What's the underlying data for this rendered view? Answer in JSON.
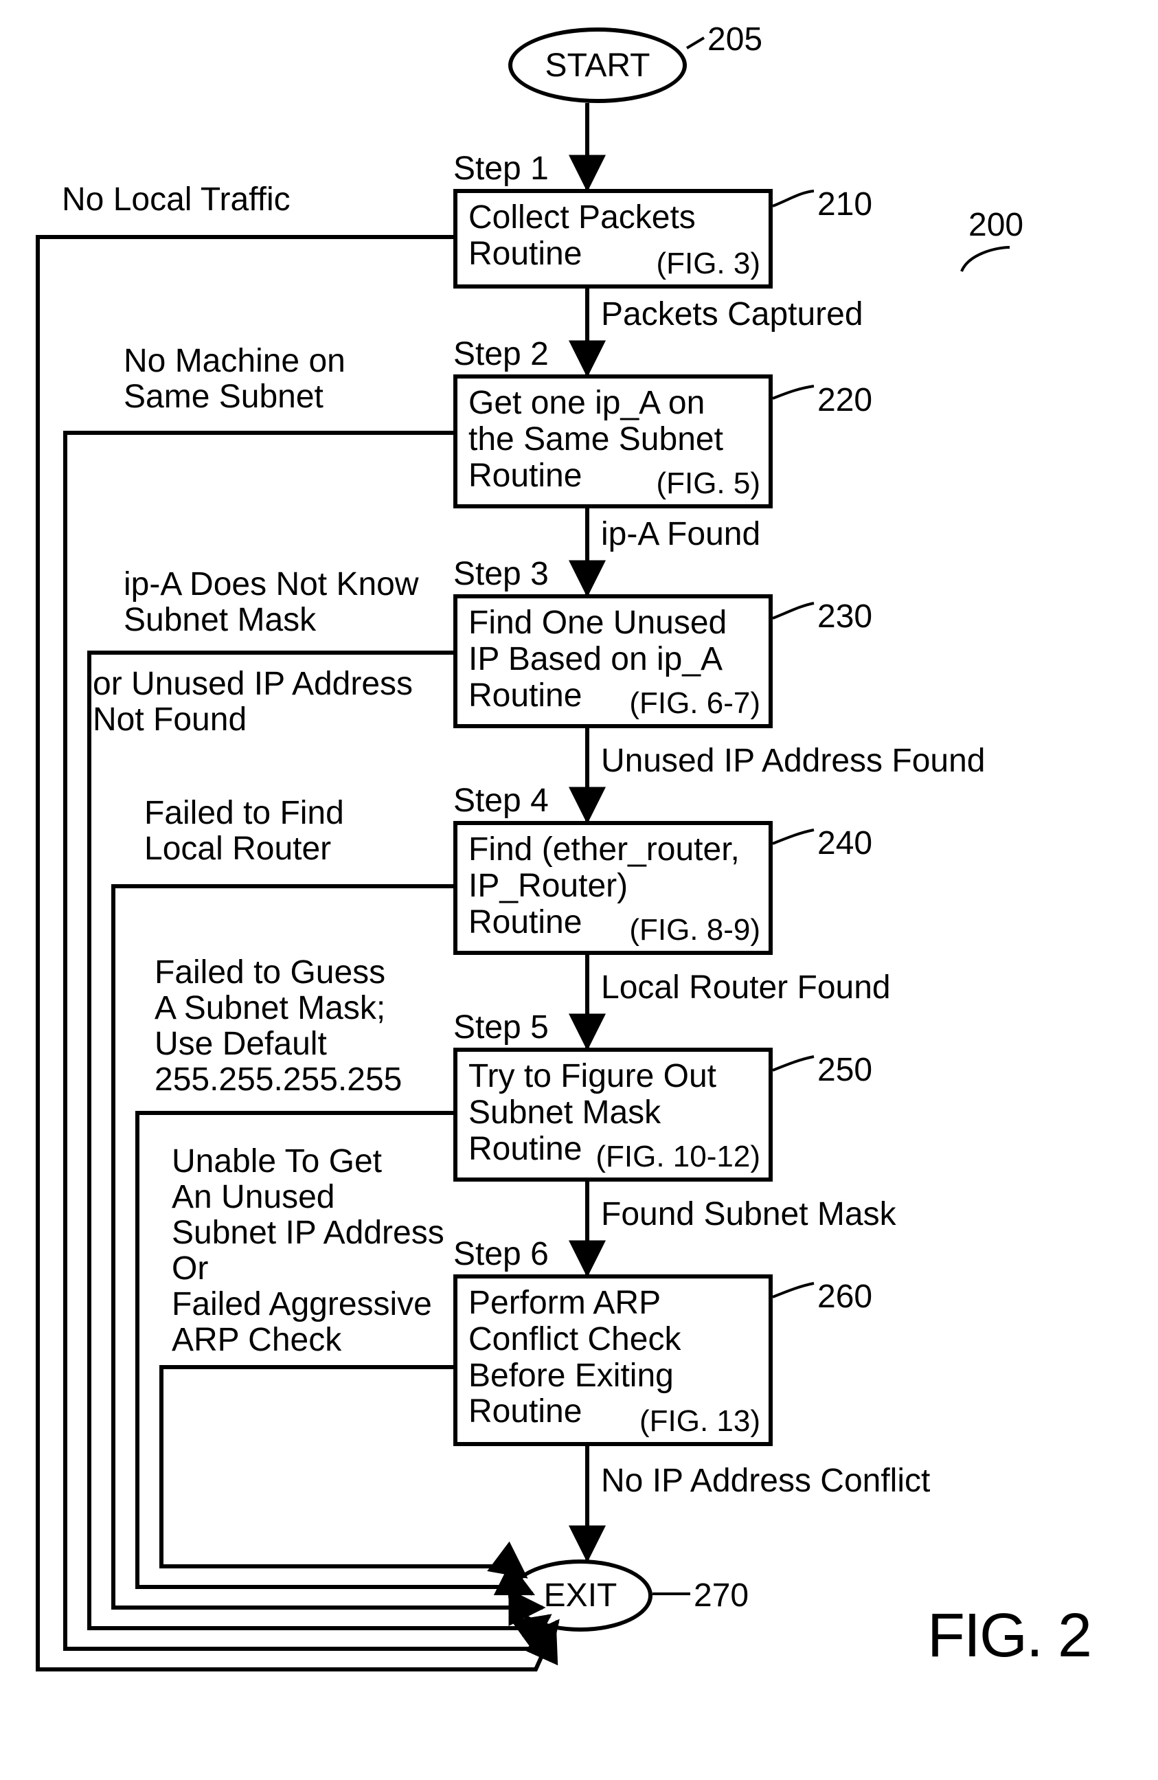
{
  "terminators": {
    "start": "START",
    "exit": "EXIT"
  },
  "refs": {
    "r205": "205",
    "r200": "200",
    "r210": "210",
    "r220": "220",
    "r230": "230",
    "r240": "240",
    "r250": "250",
    "r260": "260",
    "r270": "270"
  },
  "steps": {
    "s1": {
      "label": "Step 1",
      "line1": "Collect Packets",
      "line2": "Routine",
      "fig": "(FIG. 3)"
    },
    "s2": {
      "label": "Step 2",
      "line1": "Get one ip_A on",
      "line2": "the Same Subnet",
      "line3": "Routine",
      "fig": "(FIG. 5)"
    },
    "s3": {
      "label": "Step 3",
      "line1": "Find One Unused",
      "line2": "IP Based on ip_A",
      "line3": "Routine",
      "fig": "(FIG. 6-7)"
    },
    "s4": {
      "label": "Step 4",
      "line1": "Find (ether_router,",
      "line2": "IP_Router)",
      "line3": "Routine",
      "fig": "(FIG. 8-9)"
    },
    "s5": {
      "label": "Step 5",
      "line1": "Try to Figure Out",
      "line2": "Subnet Mask",
      "line3": "Routine",
      "fig": "(FIG. 10-12)"
    },
    "s6": {
      "label": "Step 6",
      "line1": "Perform ARP",
      "line2": "Conflict Check",
      "line3": "Before Exiting",
      "line4": "Routine",
      "fig": "(FIG. 13)"
    }
  },
  "edges": {
    "e1": "Packets Captured",
    "e2": "ip-A Found",
    "e3": "Unused IP Address Found",
    "e4": "Local Router Found",
    "e5": "Found Subnet Mask",
    "e6": "No IP Address Conflict",
    "left1": "No Local Traffic",
    "left2_l1": "No Machine on",
    "left2_l2": "Same Subnet",
    "left3_l1": "ip-A Does Not Know",
    "left3_l2": "Subnet Mask",
    "left3_l3": "or Unused IP Address",
    "left3_l4": "Not Found",
    "left4_l1": "Failed to Find",
    "left4_l2": "Local Router",
    "left5_l1": "Failed to Guess",
    "left5_l2": "A Subnet Mask;",
    "left5_l3": "Use Default",
    "left5_l4": "255.255.255.255",
    "left6_l1": "Unable To Get",
    "left6_l2": "An Unused",
    "left6_l3": "Subnet IP Address",
    "left6_l4": "Or",
    "left6_l5": "Failed Aggressive",
    "left6_l6": "ARP Check"
  },
  "figure": "FIG. 2"
}
